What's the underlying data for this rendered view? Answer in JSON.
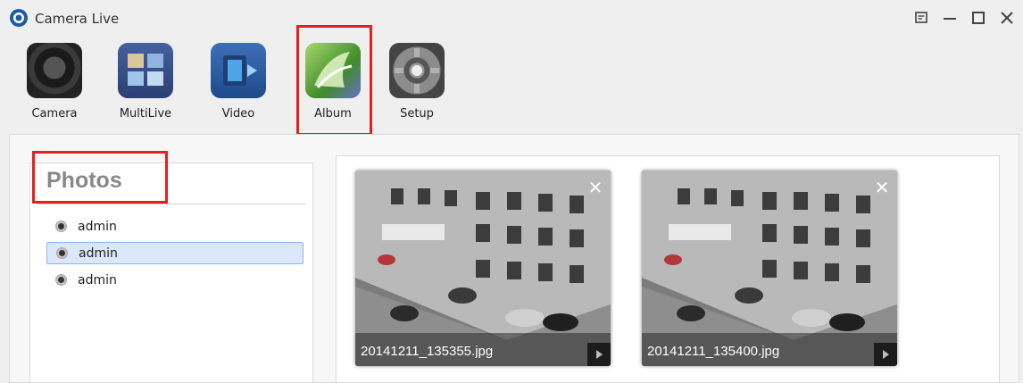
{
  "window": {
    "title": "Camera Live",
    "logo_icon": "camera-live-logo-icon",
    "controls": [
      "menu-icon",
      "minimize-icon",
      "maximize-icon",
      "close-icon"
    ]
  },
  "toolbar": {
    "items": [
      {
        "label": "Camera",
        "icon": "camera-icon"
      },
      {
        "label": "MultiLive",
        "icon": "multilive-icon"
      },
      {
        "label": "Video",
        "icon": "video-icon"
      },
      {
        "label": "Album",
        "icon": "album-icon",
        "active": true
      },
      {
        "label": "Setup",
        "icon": "setup-gear-icon"
      }
    ]
  },
  "sidebar": {
    "title": "Photos",
    "users": [
      {
        "name": "admin",
        "selected": false
      },
      {
        "name": "admin",
        "selected": true
      },
      {
        "name": "admin",
        "selected": false
      }
    ]
  },
  "photos": [
    {
      "filename": "20141211_135355.jpg",
      "close_symbol": "✕"
    },
    {
      "filename": "20141211_135400.jpg",
      "close_symbol": "✕"
    }
  ],
  "colors": {
    "highlight": "#e61e1e",
    "selected_bg": "#dbe8fb",
    "selected_border": "#8eb4e8"
  }
}
